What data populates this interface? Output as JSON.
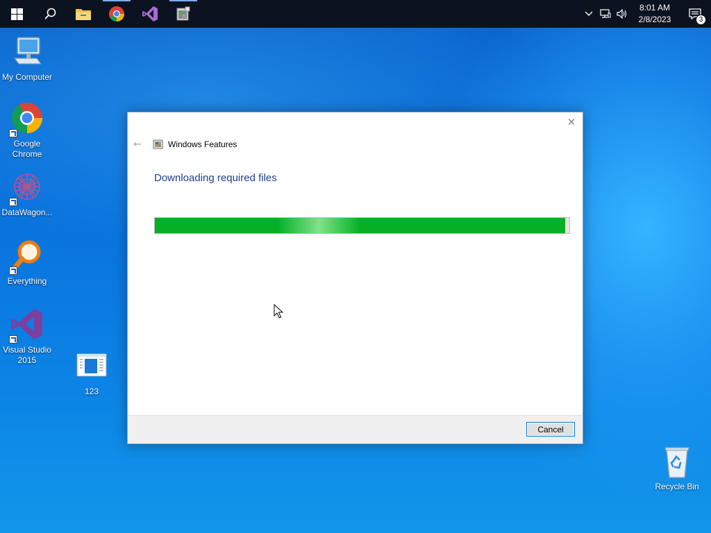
{
  "taskbar": {
    "pinned": [
      {
        "name": "start-button-windows-icon"
      },
      {
        "name": "search-icon"
      },
      {
        "name": "file-explorer-icon"
      },
      {
        "name": "chrome-icon"
      },
      {
        "name": "visual-studio-icon"
      },
      {
        "name": "windows-features-icon"
      }
    ],
    "clock": {
      "time": "8:01 AM",
      "date": "2/8/2023"
    },
    "notifications_count": "3"
  },
  "desktop": {
    "icons": [
      {
        "label": "My Computer",
        "icon": "computer-icon"
      },
      {
        "label": "Google Chrome",
        "icon": "chrome-icon"
      },
      {
        "label": "DataWagon...",
        "icon": "datawagon-icon"
      },
      {
        "label": "Everything",
        "icon": "everything-search-icon"
      },
      {
        "label": "Visual Studio 2015",
        "icon": "visual-studio-icon"
      },
      {
        "label": "123",
        "icon": "document-icon"
      },
      {
        "label": "Recycle Bin",
        "icon": "recycle-bin-icon"
      }
    ]
  },
  "dialog": {
    "title": "Windows Features",
    "heading": "Downloading required files",
    "progress": 0.99,
    "cancel_label": "Cancel"
  },
  "colors": {
    "accent": "#0078d7",
    "progress_green": "#06b025",
    "heading_blue": "#1e3f8a",
    "taskbar": "#0b1320"
  }
}
